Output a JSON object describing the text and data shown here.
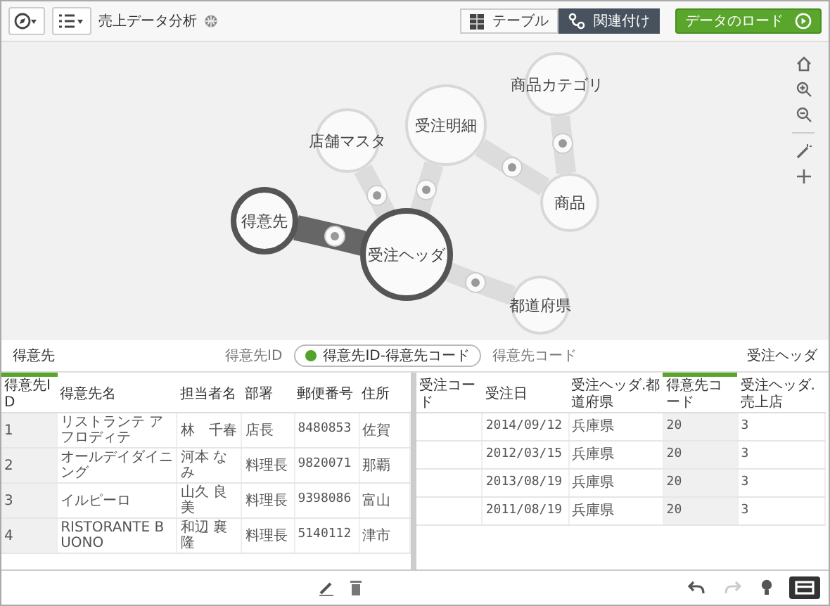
{
  "toolbar": {
    "title": "売上データ分析",
    "view_tabs": [
      {
        "label": "テーブル",
        "selected": false
      },
      {
        "label": "関連付け",
        "selected": true
      }
    ],
    "load_button": "データのロード"
  },
  "graph": {
    "nodes": [
      {
        "label": "得意先",
        "selected": true
      },
      {
        "label": "受注ヘッダ",
        "selected": true
      },
      {
        "label": "店舗マスタ",
        "selected": false
      },
      {
        "label": "受注明細",
        "selected": false
      },
      {
        "label": "商品カテゴリ",
        "selected": false
      },
      {
        "label": "商品",
        "selected": false
      },
      {
        "label": "都道府県",
        "selected": false
      }
    ],
    "links": [
      {
        "selected": true
      },
      {
        "selected": false
      },
      {
        "selected": false
      },
      {
        "selected": false
      },
      {
        "selected": false
      },
      {
        "selected": false
      }
    ]
  },
  "association_bar": {
    "left_table": "得意先",
    "left_field": "得意先ID",
    "association": "得意先ID-得意先コード",
    "right_field": "得意先コード",
    "right_table": "受注ヘッダ"
  },
  "left_table": {
    "columns": [
      {
        "label": "得意先ID",
        "selected": true
      },
      {
        "label": "得意先名",
        "selected": false
      },
      {
        "label": "担当者名",
        "selected": false
      },
      {
        "label": "部署",
        "selected": false
      },
      {
        "label": "郵便番号",
        "selected": false
      },
      {
        "label": "住所",
        "selected": false
      }
    ],
    "rows": [
      [
        "1",
        "リストランテ アフロディテ",
        "林　千春",
        "店長",
        "8480853",
        "佐賀"
      ],
      [
        "2",
        "オールデイダイニング",
        "河本 なみ",
        "料理長",
        "9820071",
        "那覇"
      ],
      [
        "3",
        "イルピーロ",
        "山久 良美",
        "料理長",
        "9398086",
        "富山"
      ],
      [
        "4",
        "RISTORANTE BUONO",
        "和辺 襄隆",
        "料理長",
        "5140112",
        "津市"
      ]
    ]
  },
  "right_table": {
    "columns": [
      {
        "label": "受注コード",
        "selected": false
      },
      {
        "label": "受注日",
        "selected": false
      },
      {
        "label": "受注ヘッダ.都道府県",
        "selected": false
      },
      {
        "label": "得意先コード",
        "selected": true
      },
      {
        "label": "受注ヘッダ.売上店",
        "selected": false
      }
    ],
    "rows": [
      [
        "",
        "2014/09/12",
        "兵庫県",
        "20",
        "3"
      ],
      [
        "",
        "2012/03/15",
        "兵庫県",
        "20",
        "3"
      ],
      [
        "",
        "2013/08/19",
        "兵庫県",
        "20",
        "3"
      ],
      [
        "",
        "2011/08/19",
        "兵庫県",
        "20",
        "3"
      ]
    ]
  },
  "bottom_tools": [
    {
      "kind": "undo",
      "disabled": false
    },
    {
      "kind": "redo",
      "disabled": true
    },
    {
      "kind": "bulb",
      "disabled": false
    },
    {
      "kind": "panel",
      "disabled": false
    }
  ]
}
